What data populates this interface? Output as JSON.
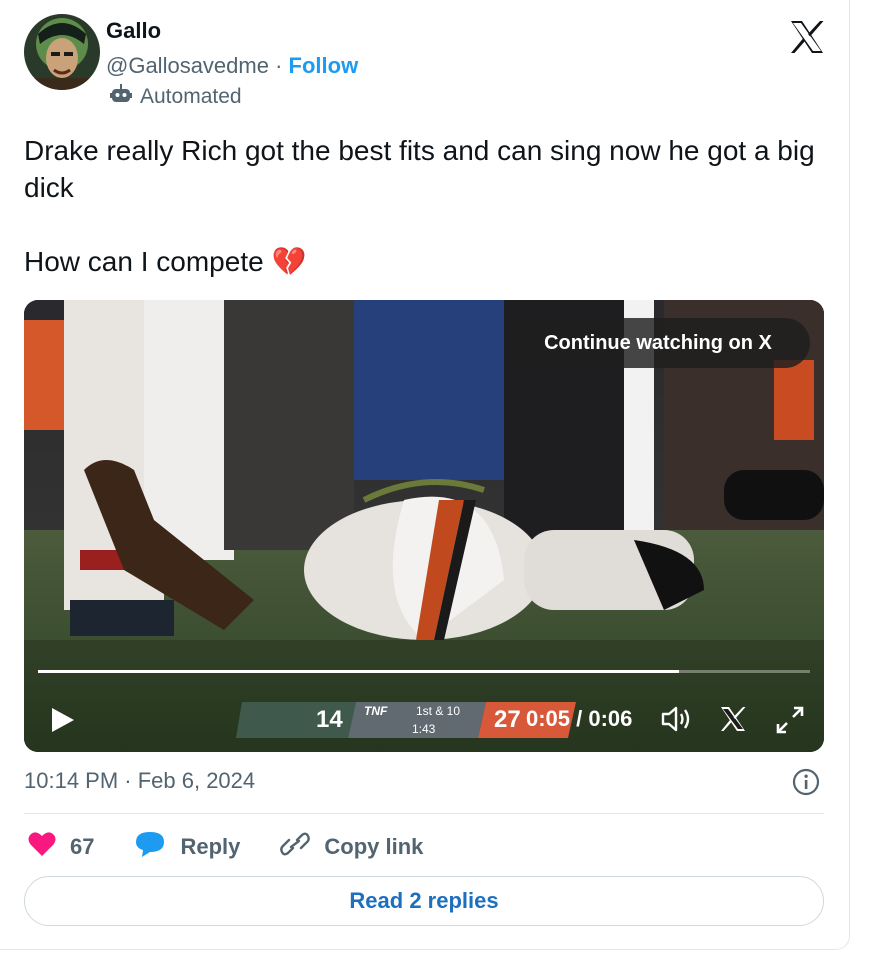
{
  "author": {
    "name": "Gallo",
    "handle": "@Gallosavedme",
    "separator": "·",
    "follow_label": "Follow",
    "automated_label": "Automated"
  },
  "tweet": {
    "line1": "Drake really Rich got the best fits and can sing now he got a big dick",
    "line2": "How can I compete 💔"
  },
  "video": {
    "continue_label": "Continue watching on X",
    "current_time": "0:05",
    "duration": "0:06",
    "time_display": "0:05 / 0:06",
    "progress": 0.83,
    "scorebug": {
      "team_left_score": "14",
      "network": "TNF",
      "down": "1st & 10",
      "clock": "1:43",
      "team_right_score": "27"
    }
  },
  "timestamp": "10:14 PM · Feb 6, 2024",
  "actions": {
    "like_count": "67",
    "reply_label": "Reply",
    "copy_label": "Copy link"
  },
  "read_replies_label": "Read 2 replies",
  "colors": {
    "accent": "#1d9bf0",
    "like": "#f91880",
    "reply_bubble": "#1d9bf0",
    "muted": "#536471"
  }
}
